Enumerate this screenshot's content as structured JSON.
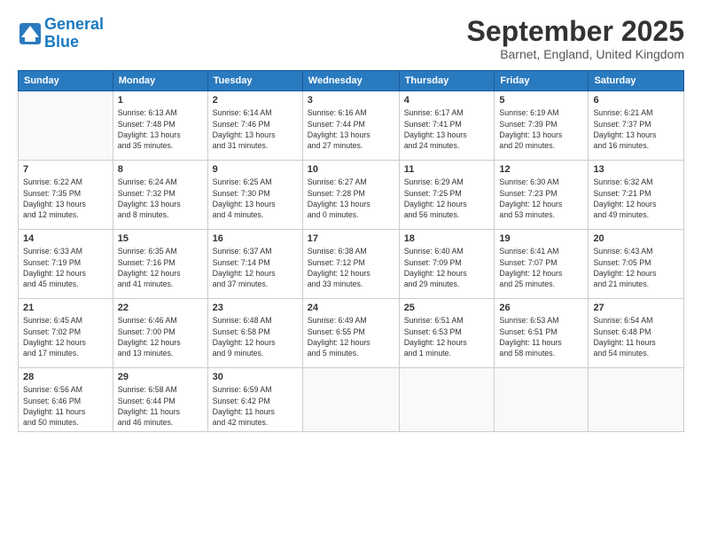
{
  "header": {
    "logo_line1": "General",
    "logo_line2": "Blue",
    "month_title": "September 2025",
    "location": "Barnet, England, United Kingdom"
  },
  "days_of_week": [
    "Sunday",
    "Monday",
    "Tuesday",
    "Wednesday",
    "Thursday",
    "Friday",
    "Saturday"
  ],
  "weeks": [
    [
      {
        "day": "",
        "info": ""
      },
      {
        "day": "1",
        "info": "Sunrise: 6:13 AM\nSunset: 7:48 PM\nDaylight: 13 hours\nand 35 minutes."
      },
      {
        "day": "2",
        "info": "Sunrise: 6:14 AM\nSunset: 7:46 PM\nDaylight: 13 hours\nand 31 minutes."
      },
      {
        "day": "3",
        "info": "Sunrise: 6:16 AM\nSunset: 7:44 PM\nDaylight: 13 hours\nand 27 minutes."
      },
      {
        "day": "4",
        "info": "Sunrise: 6:17 AM\nSunset: 7:41 PM\nDaylight: 13 hours\nand 24 minutes."
      },
      {
        "day": "5",
        "info": "Sunrise: 6:19 AM\nSunset: 7:39 PM\nDaylight: 13 hours\nand 20 minutes."
      },
      {
        "day": "6",
        "info": "Sunrise: 6:21 AM\nSunset: 7:37 PM\nDaylight: 13 hours\nand 16 minutes."
      }
    ],
    [
      {
        "day": "7",
        "info": "Sunrise: 6:22 AM\nSunset: 7:35 PM\nDaylight: 13 hours\nand 12 minutes."
      },
      {
        "day": "8",
        "info": "Sunrise: 6:24 AM\nSunset: 7:32 PM\nDaylight: 13 hours\nand 8 minutes."
      },
      {
        "day": "9",
        "info": "Sunrise: 6:25 AM\nSunset: 7:30 PM\nDaylight: 13 hours\nand 4 minutes."
      },
      {
        "day": "10",
        "info": "Sunrise: 6:27 AM\nSunset: 7:28 PM\nDaylight: 13 hours\nand 0 minutes."
      },
      {
        "day": "11",
        "info": "Sunrise: 6:29 AM\nSunset: 7:25 PM\nDaylight: 12 hours\nand 56 minutes."
      },
      {
        "day": "12",
        "info": "Sunrise: 6:30 AM\nSunset: 7:23 PM\nDaylight: 12 hours\nand 53 minutes."
      },
      {
        "day": "13",
        "info": "Sunrise: 6:32 AM\nSunset: 7:21 PM\nDaylight: 12 hours\nand 49 minutes."
      }
    ],
    [
      {
        "day": "14",
        "info": "Sunrise: 6:33 AM\nSunset: 7:19 PM\nDaylight: 12 hours\nand 45 minutes."
      },
      {
        "day": "15",
        "info": "Sunrise: 6:35 AM\nSunset: 7:16 PM\nDaylight: 12 hours\nand 41 minutes."
      },
      {
        "day": "16",
        "info": "Sunrise: 6:37 AM\nSunset: 7:14 PM\nDaylight: 12 hours\nand 37 minutes."
      },
      {
        "day": "17",
        "info": "Sunrise: 6:38 AM\nSunset: 7:12 PM\nDaylight: 12 hours\nand 33 minutes."
      },
      {
        "day": "18",
        "info": "Sunrise: 6:40 AM\nSunset: 7:09 PM\nDaylight: 12 hours\nand 29 minutes."
      },
      {
        "day": "19",
        "info": "Sunrise: 6:41 AM\nSunset: 7:07 PM\nDaylight: 12 hours\nand 25 minutes."
      },
      {
        "day": "20",
        "info": "Sunrise: 6:43 AM\nSunset: 7:05 PM\nDaylight: 12 hours\nand 21 minutes."
      }
    ],
    [
      {
        "day": "21",
        "info": "Sunrise: 6:45 AM\nSunset: 7:02 PM\nDaylight: 12 hours\nand 17 minutes."
      },
      {
        "day": "22",
        "info": "Sunrise: 6:46 AM\nSunset: 7:00 PM\nDaylight: 12 hours\nand 13 minutes."
      },
      {
        "day": "23",
        "info": "Sunrise: 6:48 AM\nSunset: 6:58 PM\nDaylight: 12 hours\nand 9 minutes."
      },
      {
        "day": "24",
        "info": "Sunrise: 6:49 AM\nSunset: 6:55 PM\nDaylight: 12 hours\nand 5 minutes."
      },
      {
        "day": "25",
        "info": "Sunrise: 6:51 AM\nSunset: 6:53 PM\nDaylight: 12 hours\nand 1 minute."
      },
      {
        "day": "26",
        "info": "Sunrise: 6:53 AM\nSunset: 6:51 PM\nDaylight: 11 hours\nand 58 minutes."
      },
      {
        "day": "27",
        "info": "Sunrise: 6:54 AM\nSunset: 6:48 PM\nDaylight: 11 hours\nand 54 minutes."
      }
    ],
    [
      {
        "day": "28",
        "info": "Sunrise: 6:56 AM\nSunset: 6:46 PM\nDaylight: 11 hours\nand 50 minutes."
      },
      {
        "day": "29",
        "info": "Sunrise: 6:58 AM\nSunset: 6:44 PM\nDaylight: 11 hours\nand 46 minutes."
      },
      {
        "day": "30",
        "info": "Sunrise: 6:59 AM\nSunset: 6:42 PM\nDaylight: 11 hours\nand 42 minutes."
      },
      {
        "day": "",
        "info": ""
      },
      {
        "day": "",
        "info": ""
      },
      {
        "day": "",
        "info": ""
      },
      {
        "day": "",
        "info": ""
      }
    ]
  ]
}
